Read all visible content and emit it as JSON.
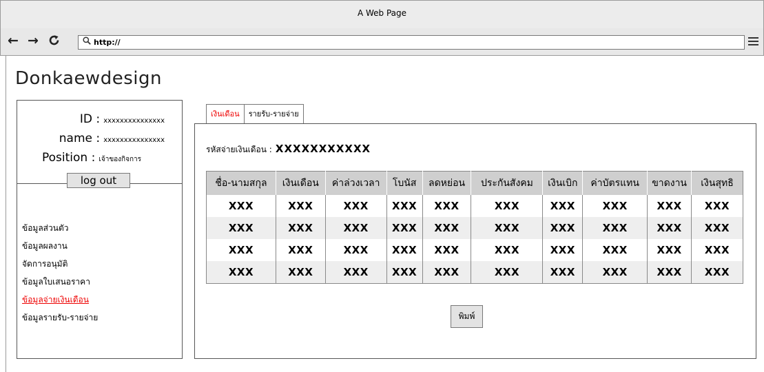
{
  "window": {
    "title": "A Web Page"
  },
  "browser": {
    "url": "http://"
  },
  "brand": "Donkaewdesign",
  "profile": {
    "id_label": "ID :",
    "id_value": "xxxxxxxxxxxxxxx",
    "name_label": "name :",
    "name_value": "xxxxxxxxxxxxxxx",
    "position_label": "Position :",
    "position_value": "เจ้าของกิจการ",
    "logout_label": "log out"
  },
  "sidebar": {
    "items": [
      {
        "label": "ข้อมูลส่วนตัว"
      },
      {
        "label": "ข้อมูลผลงาน"
      },
      {
        "label": "จัดการอนุมัติ"
      },
      {
        "label": "ข้อมูลใบเสนอราคา"
      },
      {
        "label": "ข้อมูลจ่ายเงินเดือน",
        "active": true
      },
      {
        "label": "ข้อมูลรายรับ-รายจ่าย"
      }
    ]
  },
  "tabs": [
    {
      "label": "เงินเดือน",
      "active": true
    },
    {
      "label": "รายรับ-รายจ่าย"
    }
  ],
  "salary": {
    "code_label": "รหัสจ่ายเงินเดือน :",
    "code_value": "XXXXXXXXXXX"
  },
  "table": {
    "headers": [
      "ชื่อ-นามสกุล",
      "เงินเดือน",
      "ค่าล่วงเวลา",
      "โบนัส",
      "ลดหย่อน",
      "ประกันสังคม",
      "เงินเบิก",
      "ค่าบัตรแทน",
      "ขาดงาน",
      "เงินสุทธิ"
    ],
    "rows": [
      [
        "XXX",
        "XXX",
        "XXX",
        "XXX",
        "XXX",
        "XXX",
        "XXX",
        "XXX",
        "XXX",
        "XXX"
      ],
      [
        "XXX",
        "XXX",
        "XXX",
        "XXX",
        "XXX",
        "XXX",
        "XXX",
        "XXX",
        "XXX",
        "XXX"
      ],
      [
        "XXX",
        "XXX",
        "XXX",
        "XXX",
        "XXX",
        "XXX",
        "XXX",
        "XXX",
        "XXX",
        "XXX"
      ],
      [
        "XXX",
        "XXX",
        "XXX",
        "XXX",
        "XXX",
        "XXX",
        "XXX",
        "XXX",
        "XXX",
        "XXX"
      ]
    ]
  },
  "print_label": "พิมพ์"
}
